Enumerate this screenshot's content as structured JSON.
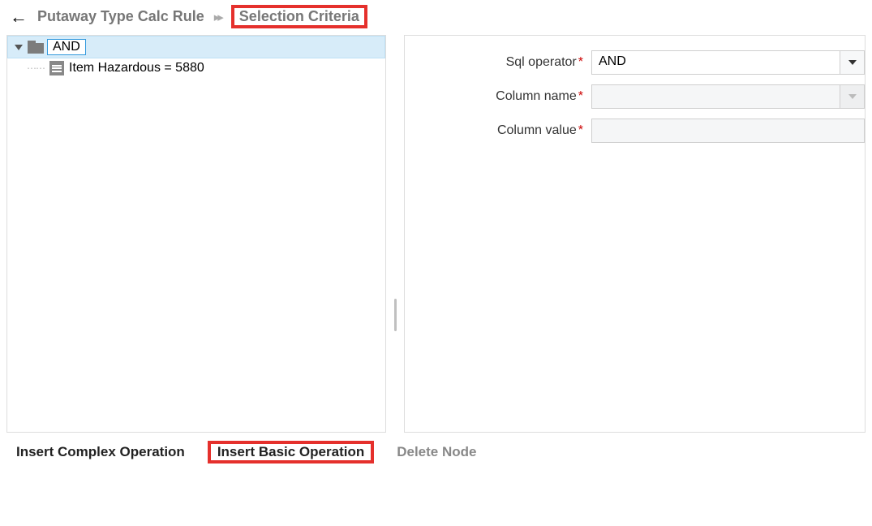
{
  "breadcrumb": {
    "parent": "Putaway Type Calc Rule",
    "current": "Selection Criteria"
  },
  "tree": {
    "root_label": "AND",
    "child_label": "Item Hazardous = 5880"
  },
  "form": {
    "sql_operator_label": "Sql operator",
    "sql_operator_value": "AND",
    "column_name_label": "Column name",
    "column_name_value": "",
    "column_value_label": "Column value",
    "column_value_value": ""
  },
  "footer": {
    "insert_complex": "Insert Complex Operation",
    "insert_basic": "Insert Basic Operation",
    "delete_node": "Delete Node"
  }
}
